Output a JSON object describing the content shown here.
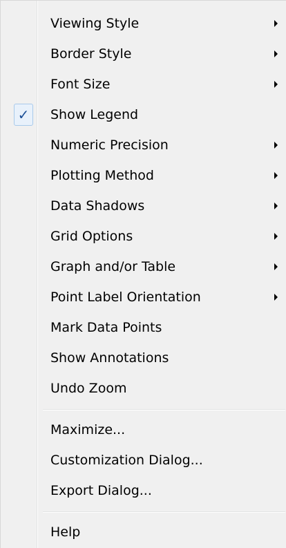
{
  "menu": {
    "items": [
      {
        "label": "Viewing Style",
        "submenu": true,
        "checked": false
      },
      {
        "label": "Border Style",
        "submenu": true,
        "checked": false
      },
      {
        "label": "Font Size",
        "submenu": true,
        "checked": false
      },
      {
        "label": "Show Legend",
        "submenu": false,
        "checked": true
      },
      {
        "label": "Numeric Precision",
        "submenu": true,
        "checked": false
      },
      {
        "label": "Plotting Method",
        "submenu": true,
        "checked": false
      },
      {
        "label": "Data Shadows",
        "submenu": true,
        "checked": false
      },
      {
        "label": "Grid Options",
        "submenu": true,
        "checked": false
      },
      {
        "label": "Graph and/or Table",
        "submenu": true,
        "checked": false
      },
      {
        "label": "Point Label Orientation",
        "submenu": true,
        "checked": false
      },
      {
        "label": "Mark Data Points",
        "submenu": false,
        "checked": false
      },
      {
        "label": "Show Annotations",
        "submenu": false,
        "checked": false
      },
      {
        "label": "Undo Zoom",
        "submenu": false,
        "checked": false
      },
      {
        "label": "Maximize...",
        "submenu": false,
        "checked": false
      },
      {
        "label": "Customization Dialog...",
        "submenu": false,
        "checked": false
      },
      {
        "label": "Export Dialog...",
        "submenu": false,
        "checked": false
      },
      {
        "label": "Help",
        "submenu": false,
        "checked": false
      }
    ],
    "check_glyph": "✓",
    "check_icon": "checkmark-icon",
    "submenu_icon": "submenu-arrow-icon"
  }
}
